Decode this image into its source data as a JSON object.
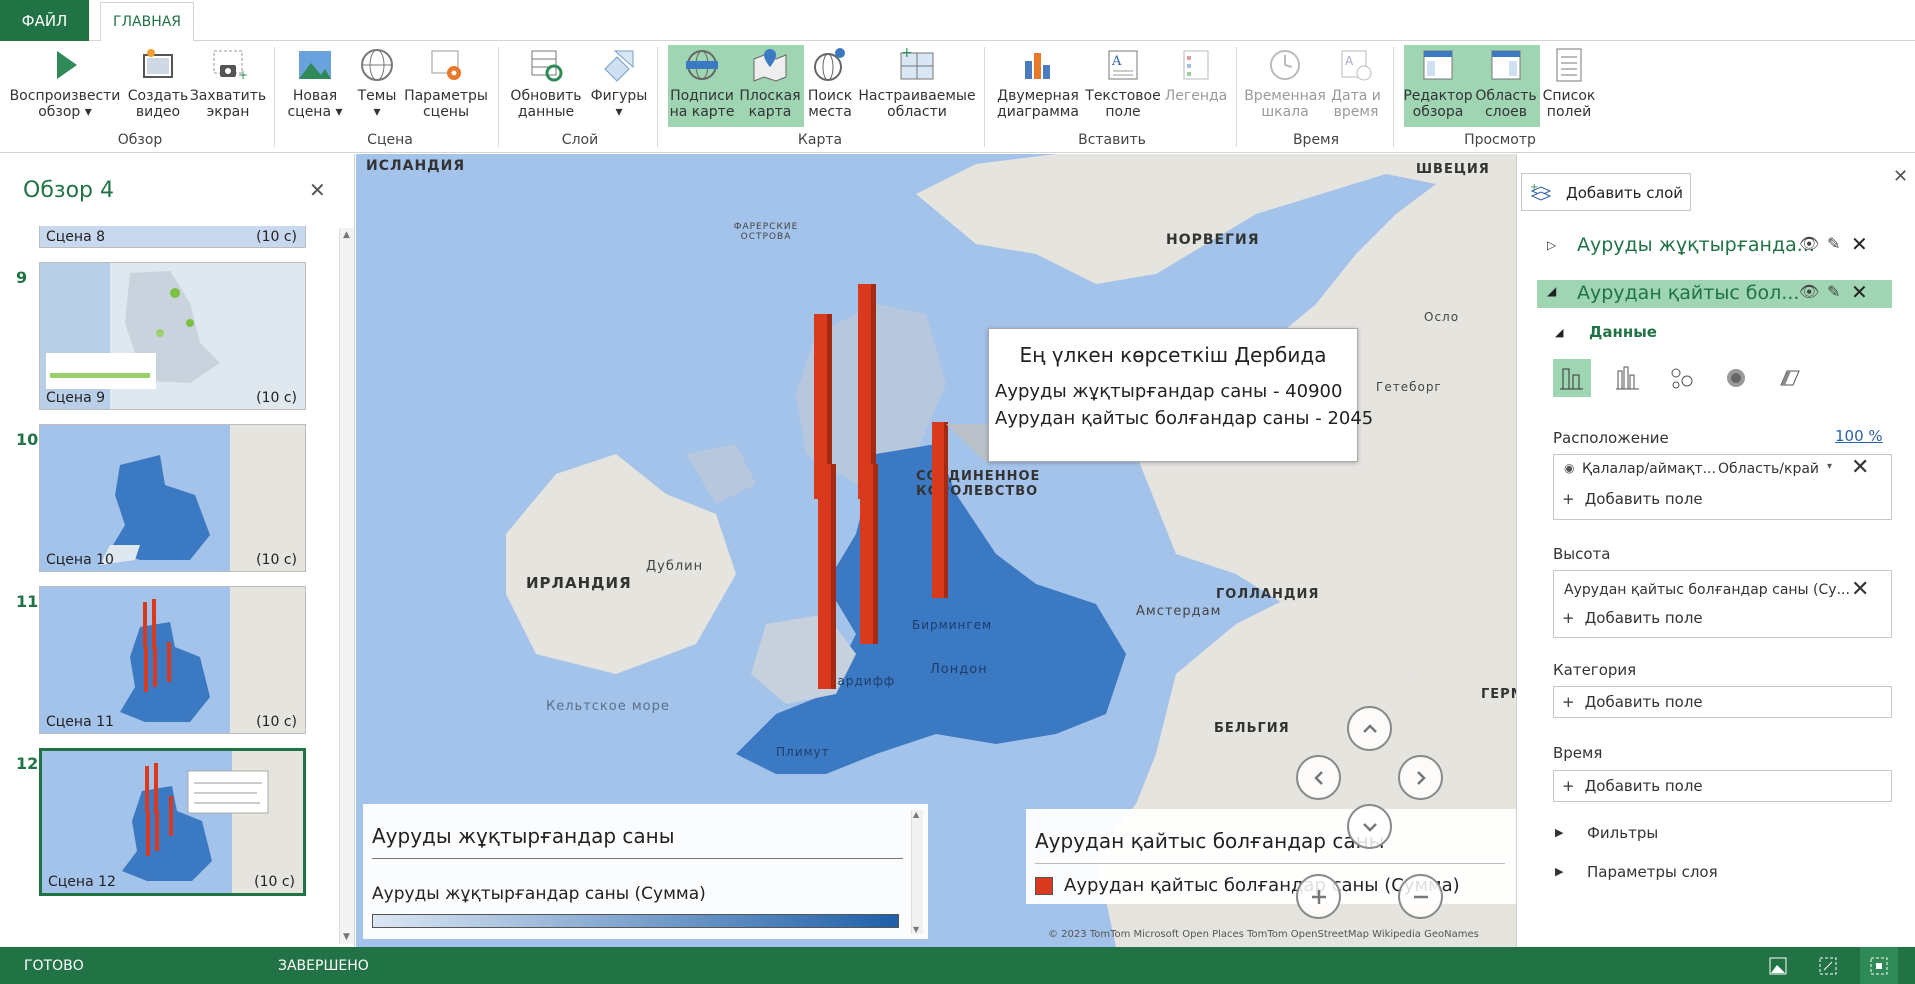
{
  "tabs": {
    "file": "ФАЙЛ",
    "home": "ГЛАВНАЯ"
  },
  "ribbon": {
    "buttons": [
      {
        "label": "Воспроизвести\nобзор ▾",
        "icon": "play-icon"
      },
      {
        "label": "Создать\nвидео",
        "icon": "video-icon"
      },
      {
        "label": "Захватить\nэкран",
        "icon": "camera-icon"
      },
      {
        "label": "Новая\nсцена ▾",
        "icon": "new-scene-icon"
      },
      {
        "label": "Темы\n▾",
        "icon": "globe-icon"
      },
      {
        "label": "Параметры\nсцены",
        "icon": "scene-options-icon"
      },
      {
        "label": "Обновить\nданные",
        "icon": "refresh-icon"
      },
      {
        "label": "Фигуры\n▾",
        "icon": "shapes-icon"
      },
      {
        "label": "Подписи\nна карте",
        "icon": "map-labels-icon"
      },
      {
        "label": "Плоская\nкарта",
        "icon": "flat-map-icon"
      },
      {
        "label": "Поиск\nместа",
        "icon": "find-location-icon"
      },
      {
        "label": "Настраиваемые\nобласти",
        "icon": "custom-regions-icon"
      },
      {
        "label": "Двумерная\nдиаграмма",
        "icon": "chart-icon"
      },
      {
        "label": "Текстовое\nполе",
        "icon": "textbox-icon"
      },
      {
        "label": "Легенда",
        "icon": "legend-icon"
      },
      {
        "label": "Временная\nшкала",
        "icon": "clock-icon"
      },
      {
        "label": "Дата и\nвремя",
        "icon": "datetime-icon"
      },
      {
        "label": "Редактор\nобзора",
        "icon": "tour-editor-icon"
      },
      {
        "label": "Область\nслоев",
        "icon": "layer-pane-icon"
      },
      {
        "label": "Список\nполей",
        "icon": "field-list-icon"
      }
    ],
    "groups": [
      "Обзор",
      "Сцена",
      "Слой",
      "Карта",
      "Вставить",
      "Время",
      "Просмотр"
    ]
  },
  "tour": {
    "title": "Обзор 4",
    "close": "✕",
    "scenes": [
      {
        "num": "",
        "name": "Сцена 8",
        "duration": "(10 с)"
      },
      {
        "num": "9",
        "name": "Сцена 9",
        "duration": "(10 с)"
      },
      {
        "num": "10",
        "name": "Сцена 10",
        "duration": "(10 с)"
      },
      {
        "num": "11",
        "name": "Сцена 11",
        "duration": "(10 с)"
      },
      {
        "num": "12",
        "name": "Сцена 12",
        "duration": "(10 с)"
      }
    ]
  },
  "map": {
    "labels": [
      "ИСЛАНДИЯ",
      "ФАРЕРСКИЕ ОСТРОВА",
      "НОРВЕГИЯ",
      "ШВЕЦИЯ",
      "СОЕДИНЕННОЕ КОРОЛЕВСТВО",
      "ИРЛАНДИЯ",
      "Дублин",
      "Кельтское море",
      "ГОЛЛАНДИЯ",
      "Амстердам",
      "БЕЛЬГИЯ",
      "ГЕРМА",
      "Лондон",
      "Бирмингем",
      "Кардифф",
      "Плимут",
      "Гетеборг",
      "Осло"
    ],
    "callout": {
      "title": "Ең үлкен көрсеткіш Дербида",
      "line1": "Ауруды жұқтырғандар саны - 40900",
      "line2": "Аурудан қайтыс болғандар саны - 2045"
    },
    "legend1": {
      "title": "Ауруды жұқтырғандар саны",
      "subtitle": "Ауруды жұқтырғандар саны (Сумма)"
    },
    "legend2": {
      "title": "Аурудан қайтыс болғандар саны",
      "item": "Аурудан қайтыс болғандар саны (Сумма)"
    },
    "copyright": "© 2023 TomTom  Microsoft  Open Places  TomTom  OpenStreetMap  Wikipedia  GeoNames"
  },
  "layers": {
    "add_layer": "Добавить слой",
    "layer1": "Ауруды жұқтырғанда...",
    "layer2": "Аурудан қайтыс бол...",
    "data_header": "Данные",
    "location_label": "Расположение",
    "location_pct": "100 %",
    "location_field": "Қалалар/аймақт...",
    "location_type": "Область/край",
    "add_field": "Добавить поле",
    "height_label": "Высота",
    "height_field": "Аурудан қайтыс болғандар саны (Су...",
    "category_label": "Категория",
    "time_label": "Время",
    "filters": "Фильтры",
    "layer_options": "Параметры слоя"
  },
  "status": {
    "ready": "ГОТОВО",
    "done": "ЗАВЕРШЕНО"
  },
  "colors": {
    "accent": "#217346",
    "highlight": "#9fd5b3",
    "bar": "#d93a1e",
    "region": "#3b79c2"
  }
}
